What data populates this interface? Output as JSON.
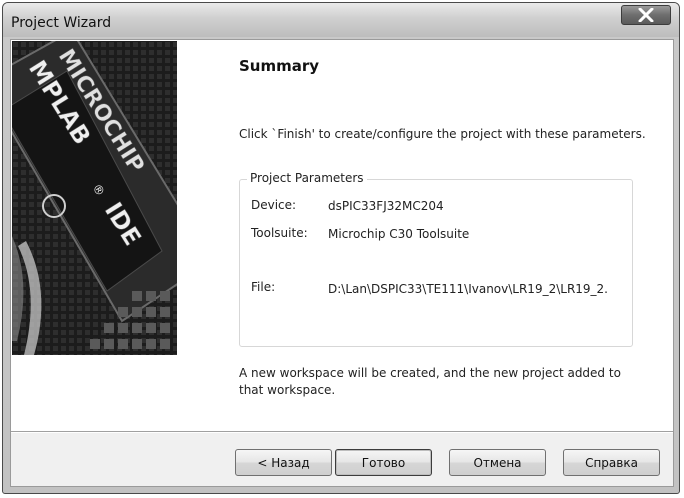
{
  "window": {
    "title": "Project Wizard"
  },
  "banner": {
    "brand_line1": "MICROCHIP",
    "brand_line2": "MPLAB",
    "brand_line3": "IDE",
    "registered_mark": "®"
  },
  "page": {
    "heading": "Summary",
    "instruction": "Click `Finish' to create/configure the project with these parameters.",
    "group_title": "Project Parameters",
    "params": [
      {
        "label": "Device:",
        "value": "dsPIC33FJ32MC204"
      },
      {
        "label": "Toolsuite:",
        "value": "Microchip C30 Toolsuite"
      },
      {
        "label": "File:",
        "value": "D:\\Lan\\DSPIC33\\TE111\\Ivanov\\LR19_2\\LR19_2."
      }
    ],
    "footer": "A new workspace will be created, and the new project added to that workspace."
  },
  "buttons": {
    "back": "< Назад",
    "finish": "Готово",
    "cancel": "Отмена",
    "help": "Справка"
  },
  "colors": {
    "banner_bg": "#1e1e1e",
    "window_frame": "#c2c2c2"
  }
}
